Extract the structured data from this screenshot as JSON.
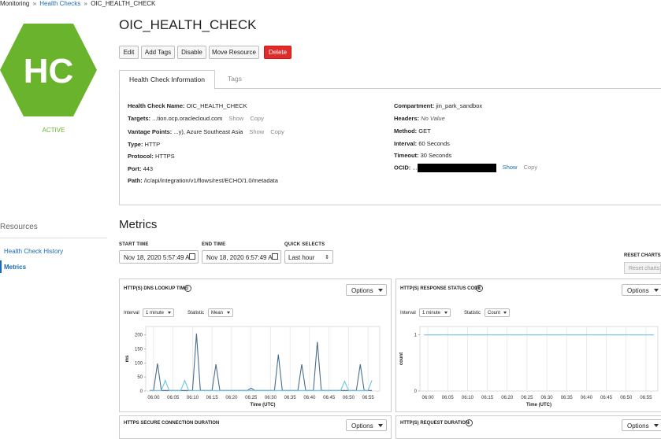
{
  "breadcrumb": {
    "root": "Monitoring",
    "parent": "Health Checks",
    "current": "OIC_HEALTH_CHECK",
    "sep": "»"
  },
  "avatar": {
    "initials": "HC",
    "color": "#6ab42d"
  },
  "status": "ACTIVE",
  "title": "OIC_HEALTH_CHECK",
  "actions": {
    "edit": "Edit",
    "add_tags": "Add Tags",
    "disable": "Disable",
    "move": "Move Resource",
    "delete": "Delete"
  },
  "tabs": {
    "info": "Health Check Information",
    "tags": "Tags"
  },
  "info": {
    "name_label": "Health Check Name:",
    "name": "OIC_HEALTH_CHECK",
    "targets_label": "Targets:",
    "targets": "...tion.ocp.oraclecloud.com",
    "vantage_label": "Vantage Points:",
    "vantage": "...y), Azure Southeast Asia",
    "type_label": "Type:",
    "type": "HTTP",
    "protocol_label": "Protocol:",
    "protocol": "HTTPS",
    "port_label": "Port:",
    "port": "443",
    "path_label": "Path:",
    "path": "/ic/api/integration/v1/flows/rest/ECHO/1.0/metadata",
    "compartment_label": "Compartment:",
    "compartment": "jin_park_sandbox",
    "headers_label": "Headers:",
    "headers": "No Value",
    "method_label": "Method:",
    "method": "GET",
    "interval_label": "Interval:",
    "interval": "60 Seconds",
    "timeout_label": "Timeout:",
    "timeout": "30 Seconds",
    "ocid_label": "OCID:",
    "ocid_prefix": "...",
    "show": "Show",
    "copy": "Copy"
  },
  "resources": {
    "heading": "Resources",
    "items": [
      "Health Check History",
      "Metrics"
    ]
  },
  "metrics": {
    "title": "Metrics",
    "start_label": "START TIME",
    "start_value": "Nov 18, 2020 5:57:49 A",
    "end_label": "END TIME",
    "end_value": "Nov 18, 2020 6:57:49 A",
    "quick_label": "QUICK SELECTS",
    "quick_value": "Last hour",
    "reset_label": "RESET CHARTS",
    "reset_button": "Reset charts"
  },
  "cards": {
    "options": "Options",
    "interval_label": "Interval",
    "interval_value": "1 minute",
    "statistic_label": "Statistic",
    "c1_title": "HTTP(S) DNS LOOKUP TIME",
    "c1_stat": "Mean",
    "c2_title": "HTTP(S) RESPONSE STATUS CODE",
    "c2_stat": "Count",
    "c3_title": "HTTPS SECURE CONNECTION DURATION",
    "c4_title": "HTTP(S) REQUEST DURATION"
  },
  "chart_data": [
    {
      "type": "line",
      "title": "HTTP(S) DNS LOOKUP TIME",
      "xlabel": "Time (UTC)",
      "ylabel": "ms",
      "x_ticks": [
        "06:00",
        "06:05",
        "06:10",
        "06:15",
        "06:20",
        "06:25",
        "06:30",
        "06:35",
        "06:40",
        "06:45",
        "06:50",
        "06:55"
      ],
      "y_ticks": [
        0,
        50,
        100,
        150,
        200
      ],
      "ylim": [
        0,
        230
      ],
      "x_minutes_start": -2,
      "x_minutes_end": 58,
      "series": [
        {
          "color": "#4a6d8c",
          "points": [
            [
              -1,
              2
            ],
            [
              0,
              2
            ],
            [
              1,
              98
            ],
            [
              2,
              2
            ],
            [
              3,
              2
            ],
            [
              4,
              2
            ],
            [
              5,
              2
            ],
            [
              6,
              2
            ],
            [
              7,
              2
            ],
            [
              8,
              2
            ],
            [
              9,
              2
            ],
            [
              10,
              2
            ],
            [
              11,
              205
            ],
            [
              12,
              2
            ],
            [
              13,
              2
            ],
            [
              14,
              2
            ],
            [
              15,
              2
            ],
            [
              16,
              95
            ],
            [
              17,
              2
            ],
            [
              18,
              2
            ],
            [
              19,
              2
            ],
            [
              20,
              2
            ],
            [
              21,
              2
            ],
            [
              22,
              2
            ],
            [
              23,
              2
            ],
            [
              24,
              2
            ],
            [
              25,
              10
            ],
            [
              26,
              2
            ],
            [
              27,
              2
            ],
            [
              28,
              2
            ],
            [
              29,
              2
            ],
            [
              30,
              2
            ],
            [
              31,
              2
            ],
            [
              32,
              130
            ],
            [
              33,
              2
            ],
            [
              34,
              2
            ],
            [
              35,
              2
            ],
            [
              36,
              2
            ],
            [
              37,
              2
            ],
            [
              38,
              95
            ],
            [
              39,
              2
            ],
            [
              40,
              2
            ],
            [
              41,
              2
            ],
            [
              42,
              175
            ],
            [
              43,
              2
            ],
            [
              44,
              2
            ],
            [
              45,
              2
            ],
            [
              46,
              2
            ],
            [
              47,
              2
            ],
            [
              48,
              2
            ],
            [
              49,
              2
            ],
            [
              50,
              2
            ],
            [
              51,
              2
            ],
            [
              52,
              2
            ],
            [
              53,
              95
            ],
            [
              54,
              2
            ],
            [
              55,
              2
            ],
            [
              56,
              2
            ]
          ]
        },
        {
          "color": "#6cc5e6",
          "points": [
            [
              -1,
              2
            ],
            [
              0,
              2
            ],
            [
              1,
              2
            ],
            [
              2,
              2
            ],
            [
              3,
              38
            ],
            [
              4,
              2
            ],
            [
              5,
              2
            ],
            [
              6,
              2
            ],
            [
              7,
              2
            ],
            [
              8,
              38
            ],
            [
              9,
              2
            ],
            [
              10,
              2
            ],
            [
              11,
              2
            ],
            [
              12,
              2
            ],
            [
              13,
              2
            ],
            [
              14,
              2
            ],
            [
              15,
              2
            ],
            [
              16,
              2
            ],
            [
              17,
              2
            ],
            [
              18,
              2
            ],
            [
              19,
              2
            ],
            [
              20,
              2
            ],
            [
              21,
              2
            ],
            [
              22,
              2
            ],
            [
              23,
              2
            ],
            [
              24,
              2
            ],
            [
              25,
              2
            ],
            [
              26,
              2
            ],
            [
              27,
              2
            ],
            [
              28,
              2
            ],
            [
              29,
              2
            ],
            [
              30,
              2
            ],
            [
              31,
              2
            ],
            [
              32,
              2
            ],
            [
              33,
              2
            ],
            [
              34,
              2
            ],
            [
              35,
              2
            ],
            [
              36,
              2
            ],
            [
              37,
              2
            ],
            [
              38,
              2
            ],
            [
              39,
              2
            ],
            [
              40,
              2
            ],
            [
              41,
              2
            ],
            [
              42,
              2
            ],
            [
              43,
              2
            ],
            [
              44,
              2
            ],
            [
              45,
              2
            ],
            [
              46,
              2
            ],
            [
              47,
              2
            ],
            [
              48,
              2
            ],
            [
              49,
              35
            ],
            [
              50,
              2
            ],
            [
              51,
              2
            ],
            [
              52,
              2
            ],
            [
              53,
              2
            ],
            [
              54,
              2
            ],
            [
              55,
              2
            ],
            [
              56,
              38
            ]
          ]
        }
      ]
    },
    {
      "type": "line",
      "title": "HTTP(S) RESPONSE STATUS CODE",
      "xlabel": "Time (UTC)",
      "ylabel": "count",
      "x_ticks": [
        "06:00",
        "06:05",
        "06:10",
        "06:15",
        "06:20",
        "06:25",
        "06:30",
        "06:35",
        "06:40",
        "06:45",
        "06:50",
        "06:55"
      ],
      "y_ticks": [
        0,
        1
      ],
      "ylim": [
        0,
        1.15
      ],
      "x_minutes_start": -2,
      "x_minutes_end": 58,
      "series": [
        {
          "color": "#6cc5e6",
          "points": [
            [
              -1,
              1
            ],
            [
              57,
              1
            ]
          ]
        }
      ]
    }
  ]
}
